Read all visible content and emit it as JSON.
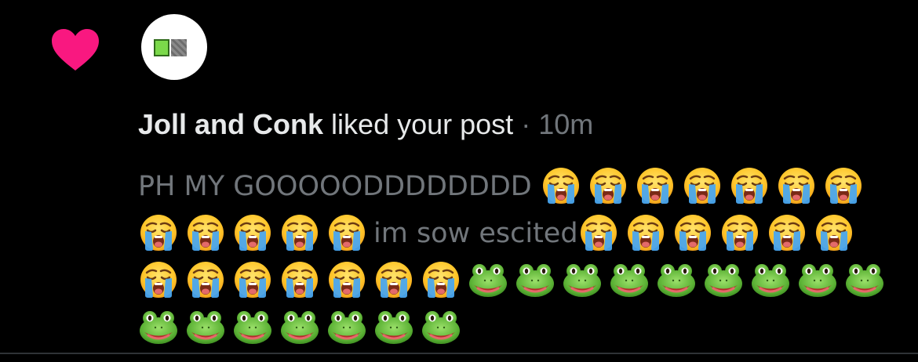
{
  "notification": {
    "user_name": "Joll and Conk",
    "action_text": "liked your post",
    "separator": "·",
    "time": "10m",
    "post": {
      "segments": [
        {
          "type": "text",
          "value": "PH MY GOOOOODDDDDDDD"
        },
        {
          "type": "emoji",
          "icon": "loudly-crying-face",
          "count": 12
        },
        {
          "type": "text",
          "value": "im sow escited"
        },
        {
          "type": "emoji",
          "icon": "loudly-crying-face",
          "count": 13
        },
        {
          "type": "emoji",
          "icon": "frog-face",
          "count": 16
        }
      ]
    }
  },
  "colors": {
    "background": "#000000",
    "heart": "#f91880",
    "primary_text": "#e7e9ea",
    "secondary_text": "#71767b"
  }
}
